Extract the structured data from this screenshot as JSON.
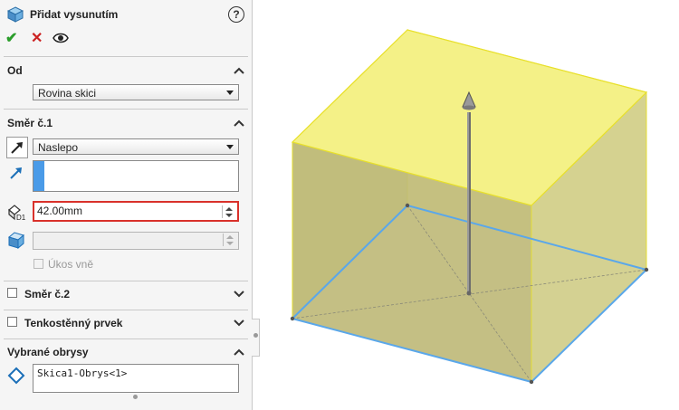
{
  "feature": {
    "title": "Přidat vysunutím",
    "help_label": "?"
  },
  "actions": {
    "ok_glyph": "✔",
    "cancel_glyph": "✕"
  },
  "from_section": {
    "title": "Od",
    "selected": "Rovina skici"
  },
  "direction1": {
    "title": "Směr č.1",
    "end_condition": "Naslepo",
    "depth_value": "42.00mm",
    "draft_label": "Úkos vně",
    "draft_checked": false
  },
  "direction2": {
    "title": "Směr č.2",
    "checked": false
  },
  "thin_feature": {
    "title": "Tenkostěnný prvek",
    "checked": false
  },
  "selected_contours": {
    "title": "Vybrané obrysy",
    "items": [
      "Skica1-Obrys<1>"
    ]
  },
  "colors": {
    "accent": "#4a9be8",
    "active_border": "#d9312b",
    "preview_fill": "#f4f187",
    "preview_edge": "#e8e02a"
  }
}
